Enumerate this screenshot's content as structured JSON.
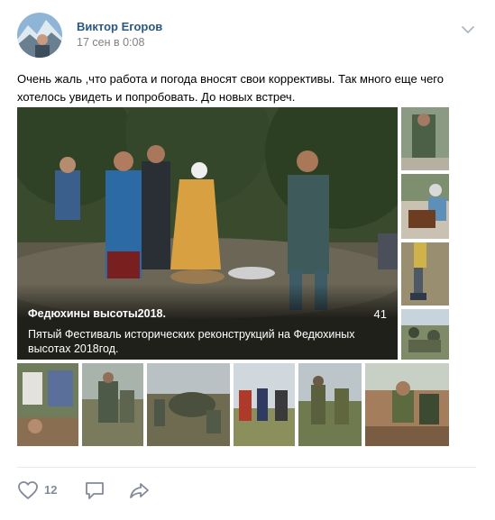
{
  "post": {
    "author": "Виктор Егоров",
    "date": "17 сен в 0:08",
    "text": "Очень жаль ,что работа и погода вносят свои коррективы. Так много еще чего хотелось увидеть и попробовать. До новых встреч."
  },
  "album": {
    "title": "Федюхины высоты2018.",
    "count": "41",
    "description": "Пятый Фестиваль исторических реконструкций на Федюхиных высотах 2018год."
  },
  "actions": {
    "likes": "12"
  },
  "colors": {
    "author_link": "#2a5885",
    "meta_gray": "#828282",
    "icon_gray": "#828a99",
    "divider": "#e7e8ec"
  },
  "icons": [
    "chevron-down-icon",
    "heart-icon",
    "comment-icon",
    "share-icon"
  ]
}
